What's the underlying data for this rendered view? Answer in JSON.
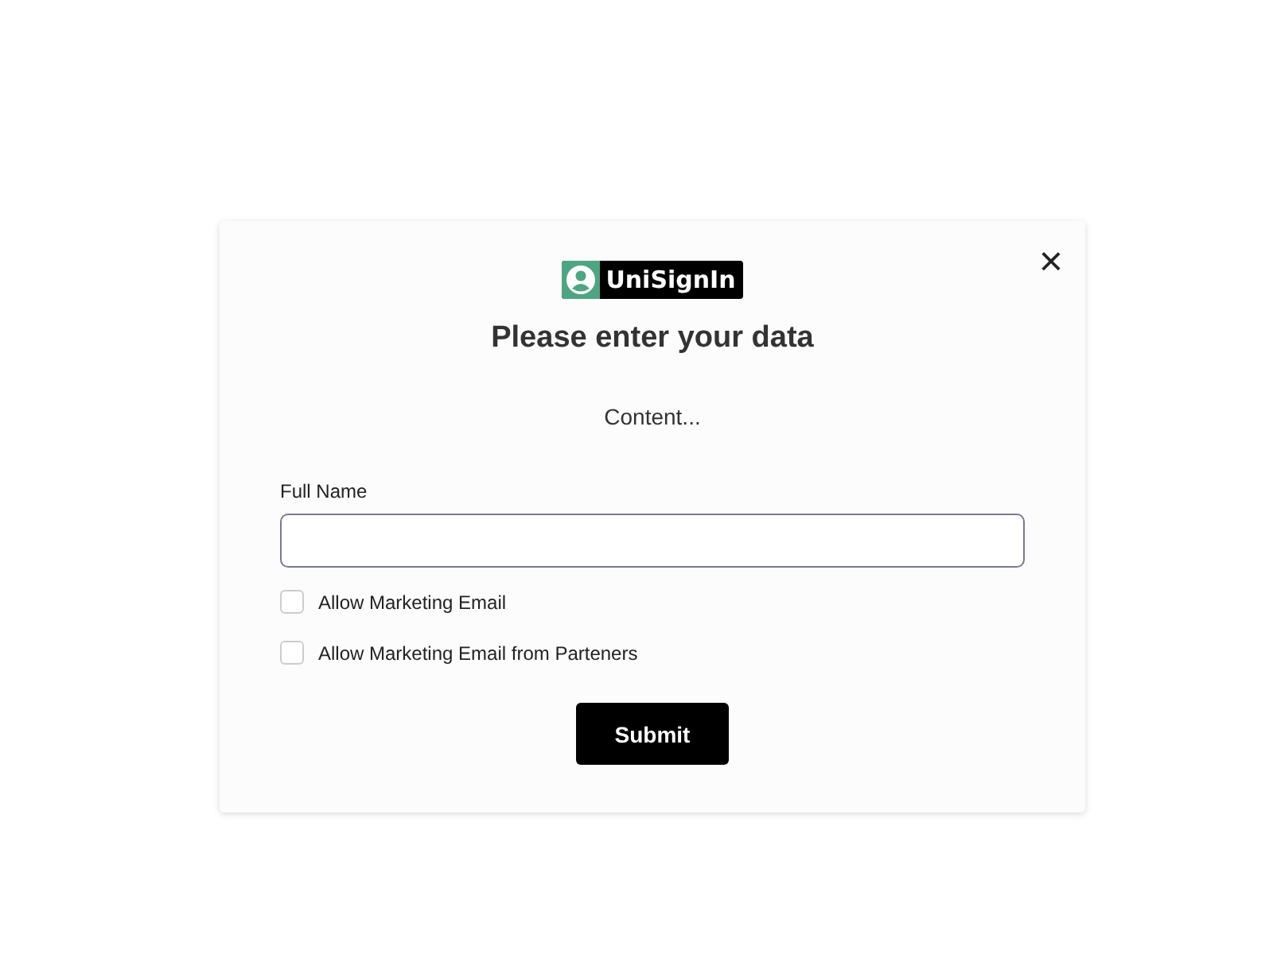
{
  "dialog": {
    "logo_text": "UniSignIn",
    "close": "×",
    "title": "Please enter your data",
    "content": "Content...",
    "field": {
      "label": "Full Name"
    },
    "checkboxes": [
      {
        "label": "Allow Marketing Email",
        "checked": false
      },
      {
        "label": "Allow Marketing Email from Parteners",
        "checked": false
      }
    ],
    "submit": "Submit"
  }
}
